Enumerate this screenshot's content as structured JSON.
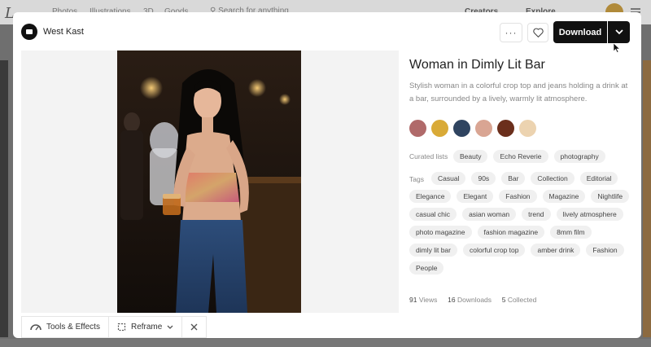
{
  "background": {
    "logo": "L",
    "nav": [
      "Photos",
      "Illustrations",
      "3D",
      "Goods"
    ],
    "search_placeholder": "Search for anything",
    "right": [
      "Creators",
      "Explore"
    ]
  },
  "modal": {
    "author": "West Kast",
    "more_label": "···",
    "download_label": "Download",
    "title": "Woman in Dimly Lit Bar",
    "description": "Stylish woman in a colorful crop top and jeans holding a drink at a bar, surrounded by a lively, warmly lit atmosphere.",
    "palette": [
      "#b06a6a",
      "#d9aa37",
      "#2f4460",
      "#d9a593",
      "#6b2f1c",
      "#ecd3b0"
    ],
    "curated_label": "Curated lists",
    "curated": [
      "Beauty",
      "Echo Reverie",
      "photography"
    ],
    "tags_label": "Tags",
    "tags": [
      "Casual",
      "90s",
      "Bar",
      "Collection",
      "Editorial",
      "Elegance",
      "Elegant",
      "Fashion",
      "Magazine",
      "Nightlife",
      "casual chic",
      "asian woman",
      "trend",
      "lively atmosphere",
      "photo magazine",
      "fashion magazine",
      "8mm film",
      "dimly lit bar",
      "colorful crop top",
      "amber drink",
      "Fashion",
      "People"
    ],
    "stats": {
      "views": "91",
      "views_label": "Views",
      "downloads": "16",
      "downloads_label": "Downloads",
      "collected": "5",
      "collected_label": "Collected"
    }
  },
  "toolbar": {
    "tools_label": "Tools & Effects",
    "reframe_label": "Reframe"
  }
}
